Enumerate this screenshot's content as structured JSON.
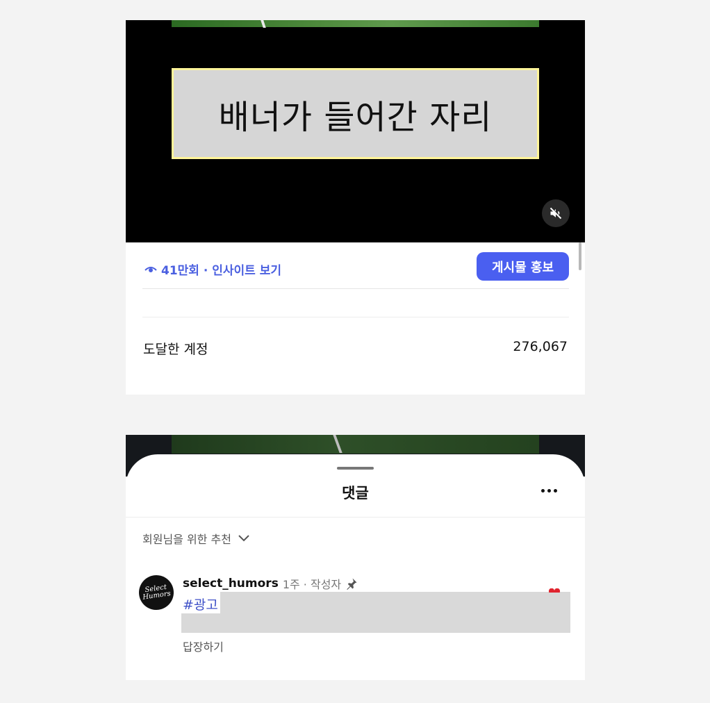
{
  "video": {
    "banner_text": "배너가 들어간 자리",
    "mute_icon": "speaker-muted-icon"
  },
  "insights": {
    "views_icon": "eye-icon",
    "views_text": "41만회 · 인사이트 보기",
    "promote_button": "게시물 홍보",
    "metric_label": "도달한 계정",
    "metric_value": "276,067"
  },
  "comments": {
    "title": "댓글",
    "sort_label": "회원님을 위한 추천",
    "items": [
      {
        "avatar_text": "Select Humors",
        "username": "select_humors",
        "meta": "1주 · 작성자",
        "text": "#광고",
        "reply_label": "답장하기",
        "pinned": true
      }
    ]
  },
  "colors": {
    "accent": "#4a5ff0",
    "link": "#4a5fe0",
    "banner_border": "#fff59a",
    "banner_fill": "#d6d6d6",
    "page_bg": "#f3f3f3"
  }
}
